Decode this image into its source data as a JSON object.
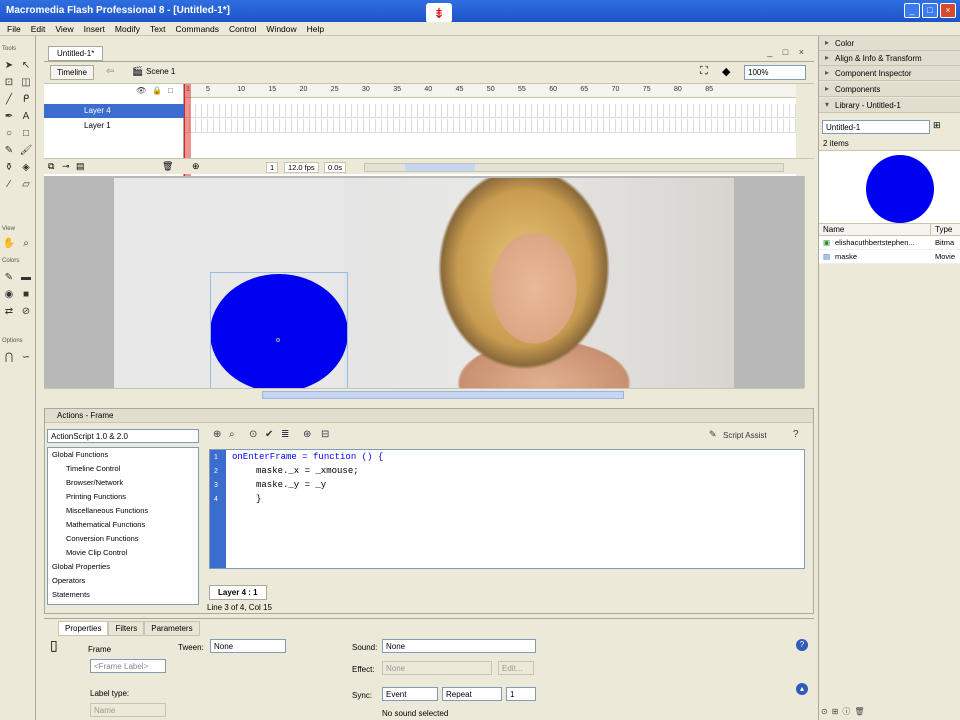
{
  "window": {
    "title": "Macromedia Flash Professional 8 - [Untitled-1*]",
    "controls": [
      "_",
      "□",
      "×"
    ]
  },
  "menubar": {
    "items": [
      "File",
      "Edit",
      "View",
      "Insert",
      "Modify",
      "Text",
      "Commands",
      "Control",
      "Window",
      "Help"
    ]
  },
  "tools": {
    "headers": [
      "Tools",
      "View",
      "Colors",
      "Options"
    ]
  },
  "document": {
    "tab_label": "Untitled-1*",
    "timeline_button": "Timeline",
    "scene_label": "Scene 1",
    "zoom": "100%"
  },
  "timeline": {
    "layers": [
      {
        "name": "Layer 4",
        "selected": true
      },
      {
        "name": "Layer 1",
        "selected": false
      }
    ],
    "ruler": [
      "1",
      "5",
      "10",
      "15",
      "20",
      "25",
      "30",
      "35",
      "40",
      "45",
      "50",
      "55",
      "60",
      "65",
      "70",
      "75",
      "80",
      "85"
    ],
    "status": {
      "frame": "1",
      "fps": "12.0 fps",
      "time": "0.0s"
    }
  },
  "library_panel": {
    "collapsed_headers": [
      "Color",
      "Align & Info & Transform",
      "Component Inspector",
      "Components"
    ],
    "library_header": "Library - Untitled-1",
    "document_select": "Untitled-1",
    "item_count": "2 items",
    "columns": [
      "Name",
      "Type"
    ],
    "items": [
      {
        "name": "elishacuthbertstephen...",
        "type": "Bitma"
      },
      {
        "name": "maske",
        "type": "Movie"
      }
    ]
  },
  "actions": {
    "header": "Actions - Frame",
    "version_select": "ActionScript 1.0 & 2.0",
    "tree": [
      "Global Functions",
      "Timeline Control",
      "Browser/Network",
      "Printing Functions",
      "Miscellaneous Functions",
      "Mathematical Functions",
      "Conversion Functions",
      "Movie Clip Control",
      "Global Properties",
      "Operators",
      "Statements"
    ],
    "script_assist": "Script Assist",
    "code_lines": [
      "onEnterFrame = function () {",
      "maske._x = _xmouse;",
      "maske._y = _y",
      "}"
    ],
    "line_numbers": [
      "1",
      "2",
      "3",
      "4"
    ],
    "tab_label": "Layer 4 : 1",
    "status": "Line 3 of 4, Col 15"
  },
  "properties": {
    "tabs": [
      "Properties",
      "Filters",
      "Parameters"
    ],
    "frame_label": "Frame",
    "frame_placeholder": "<Frame Label>",
    "tween_label": "Tween:",
    "tween_value": "None",
    "sound_label": "Sound:",
    "sound_value": "None",
    "effect_label": "Effect:",
    "effect_value": "None",
    "edit_button": "Edit...",
    "label_type_label": "Label type:",
    "label_type_value": "Name",
    "sync_label": "Sync:",
    "sync_value": "Event",
    "repeat_value": "Repeat",
    "repeat_count": "1",
    "no_sound": "No sound selected"
  }
}
